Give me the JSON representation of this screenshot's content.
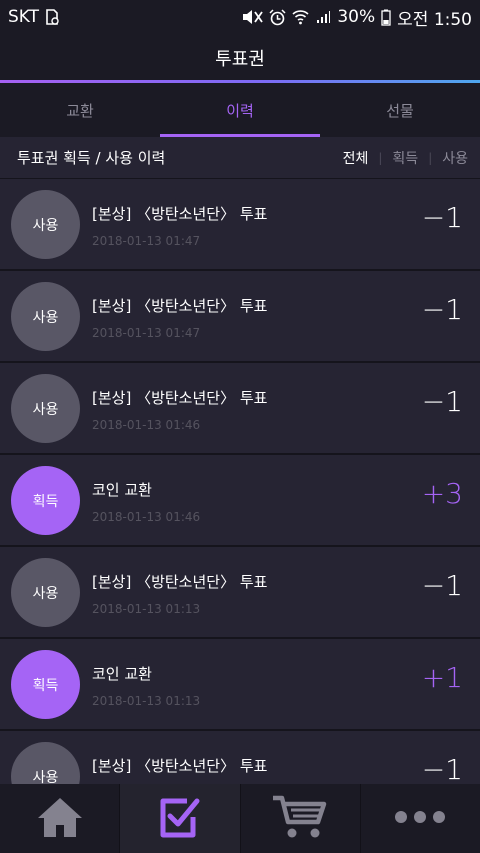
{
  "status_bar": {
    "carrier": "SKT",
    "battery": "30%",
    "time": "오전 1:50"
  },
  "app_bar": {
    "title": "투표권"
  },
  "tabs": [
    {
      "label": "교환",
      "active": false
    },
    {
      "label": "이력",
      "active": true
    },
    {
      "label": "선물",
      "active": false
    }
  ],
  "history": {
    "title": "투표권 획득 / 사용 이력",
    "filters": [
      "전체",
      "획득",
      "사용"
    ],
    "active_filter": "전체"
  },
  "items": [
    {
      "type": "사용",
      "title": "[본상] 〈방탄소년단〉 투표",
      "date": "2018-01-13 01:47",
      "amount": "−1"
    },
    {
      "type": "사용",
      "title": "[본상] 〈방탄소년단〉 투표",
      "date": "2018-01-13 01:47",
      "amount": "−1"
    },
    {
      "type": "사용",
      "title": "[본상] 〈방탄소년단〉 투표",
      "date": "2018-01-13 01:46",
      "amount": "−1"
    },
    {
      "type": "획득",
      "title": "코인 교환",
      "date": "2018-01-13 01:46",
      "amount": "+3"
    },
    {
      "type": "사용",
      "title": "[본상] 〈방탄소년단〉 투표",
      "date": "2018-01-13 01:13",
      "amount": "−1"
    },
    {
      "type": "획득",
      "title": "코인 교환",
      "date": "2018-01-13 01:13",
      "amount": "+1"
    },
    {
      "type": "사용",
      "title": "[본상] 〈방탄소년단〉 투표",
      "date": "",
      "amount": "−1"
    }
  ],
  "bottom_nav": [
    {
      "icon": "home-icon",
      "active": false
    },
    {
      "icon": "vote-check-icon",
      "active": true
    },
    {
      "icon": "cart-icon",
      "active": false
    },
    {
      "icon": "more-icon",
      "active": false
    }
  ],
  "colors": {
    "accent": "#a564f5",
    "background": "#262433",
    "bar": "#1b1a24",
    "use_circle": "#595766"
  }
}
